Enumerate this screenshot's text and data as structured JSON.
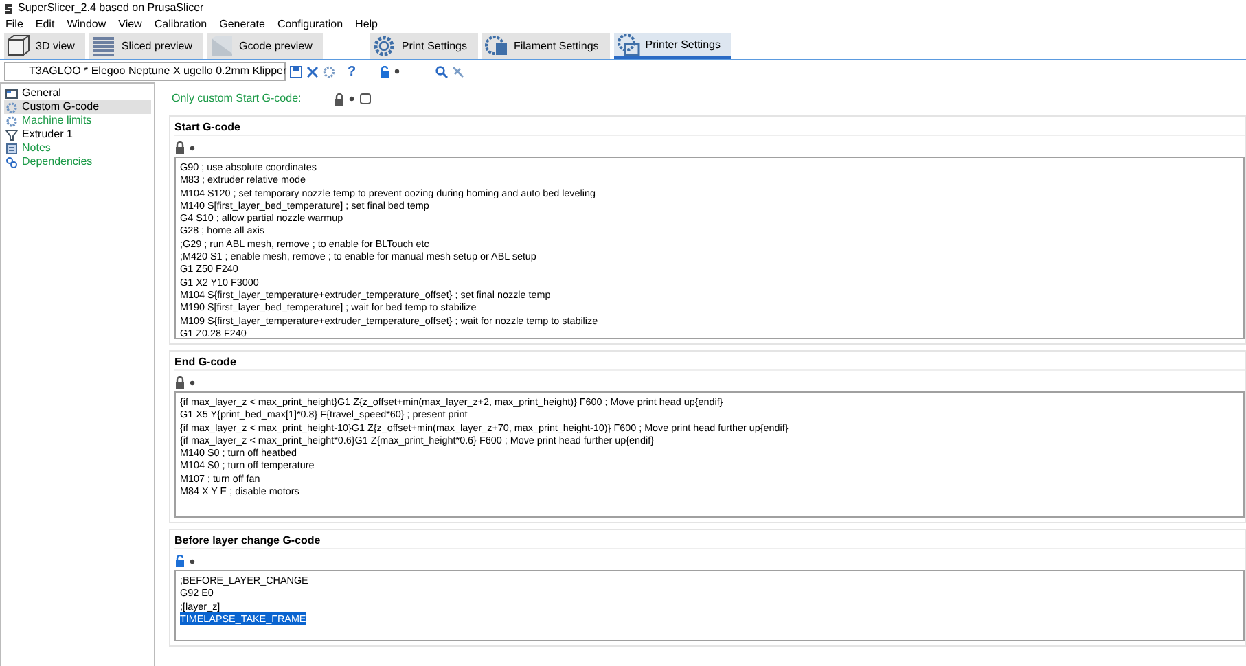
{
  "window": {
    "title": "SuperSlicer_2.4  based on PrusaSlicer"
  },
  "menu": [
    "File",
    "Edit",
    "Window",
    "View",
    "Calibration",
    "Generate",
    "Configuration",
    "Help"
  ],
  "tabs": [
    {
      "label": "3D view",
      "kind": "cube",
      "selected": false
    },
    {
      "label": "Sliced preview",
      "kind": "layers",
      "selected": false
    },
    {
      "label": "Gcode preview",
      "kind": "block",
      "selected": false
    },
    {
      "label": "Print Settings",
      "kind": "gear",
      "selected": false
    },
    {
      "label": "Filament Settings",
      "kind": "spool",
      "selected": false
    },
    {
      "label": "Printer Settings",
      "kind": "printer",
      "selected": true
    }
  ],
  "preset": {
    "value": "T3AGLOO * Elegoo Neptune X ugello 0.2mm Klipper",
    "locked": false,
    "help": "?"
  },
  "sidebar": {
    "items": [
      {
        "label": "General",
        "kind": "window",
        "color": "#000000",
        "selected": false
      },
      {
        "label": "Custom G-code",
        "kind": "gear",
        "color": "#000000",
        "selected": true
      },
      {
        "label": "Machine limits",
        "kind": "gear",
        "color": "#1b9a47",
        "selected": false
      },
      {
        "label": "Extruder 1",
        "kind": "funnel",
        "color": "#000000",
        "selected": false
      },
      {
        "label": "Notes",
        "kind": "note",
        "color": "#1b9a47",
        "selected": false
      },
      {
        "label": "Dependencies",
        "kind": "link",
        "color": "#1b9a47",
        "selected": false
      }
    ]
  },
  "only_custom": {
    "label": "Only custom Start G-code:",
    "locked": true,
    "checked": false
  },
  "sections": [
    {
      "title": "Start G-code",
      "locked": true,
      "lines": [
        {
          "text": "G90 ; use absolute coordinates",
          "selected": false
        },
        {
          "text": "M83 ; extruder relative mode",
          "selected": false
        },
        {
          "text": "M104 S120 ; set temporary nozzle temp to prevent oozing during homing and auto bed leveling",
          "selected": false
        },
        {
          "text": "M140 S[first_layer_bed_temperature] ; set final bed temp",
          "selected": false
        },
        {
          "text": "G4 S10 ; allow partial nozzle warmup",
          "selected": false
        },
        {
          "text": "G28 ; home all axis",
          "selected": false
        },
        {
          "text": ";G29  ; run ABL mesh, remove ; to enable for BLTouch etc",
          "selected": false
        },
        {
          "text": ";M420 S1 ; enable mesh, remove ; to enable for manual mesh setup or ABL setup",
          "selected": false
        },
        {
          "text": "G1 Z50 F240",
          "selected": false
        },
        {
          "text": "G1 X2 Y10 F3000",
          "selected": false
        },
        {
          "text": "M104 S{first_layer_temperature+extruder_temperature_offset} ; set final nozzle temp",
          "selected": false
        },
        {
          "text": "M190 S[first_layer_bed_temperature] ; wait for bed temp to stabilize",
          "selected": false
        },
        {
          "text": "M109 S{first_layer_temperature+extruder_temperature_offset} ; wait for nozzle temp to stabilize",
          "selected": false
        },
        {
          "text": "G1 Z0.28 F240",
          "selected": false
        }
      ]
    },
    {
      "title": "End G-code",
      "locked": true,
      "lines": [
        {
          "text": "{if max_layer_z < max_print_height}G1 Z{z_offset+min(max_layer_z+2, max_print_height)} F600 ; Move print head up{endif}",
          "selected": false
        },
        {
          "text": "G1 X5 Y{print_bed_max[1]*0.8} F{travel_speed*60} ; present print",
          "selected": false
        },
        {
          "text": "{if max_layer_z < max_print_height-10}G1 Z{z_offset+min(max_layer_z+70, max_print_height-10)} F600 ; Move print head further up{endif}",
          "selected": false
        },
        {
          "text": "{if max_layer_z < max_print_height*0.6}G1 Z{max_print_height*0.6} F600 ; Move print head further up{endif}",
          "selected": false
        },
        {
          "text": "M140 S0 ; turn off heatbed",
          "selected": false
        },
        {
          "text": "M104 S0 ; turn off temperature",
          "selected": false
        },
        {
          "text": "M107 ; turn off fan",
          "selected": false
        },
        {
          "text": "M84 X Y E ; disable motors",
          "selected": false
        }
      ]
    },
    {
      "title": "Before layer change G-code",
      "locked": false,
      "lines": [
        {
          "text": ";BEFORE_LAYER_CHANGE",
          "selected": false
        },
        {
          "text": "G92 E0",
          "selected": false
        },
        {
          "text": ";[layer_z]",
          "selected": false
        },
        {
          "text": "TIMELAPSE_TAKE_FRAME",
          "selected": true
        }
      ]
    }
  ]
}
